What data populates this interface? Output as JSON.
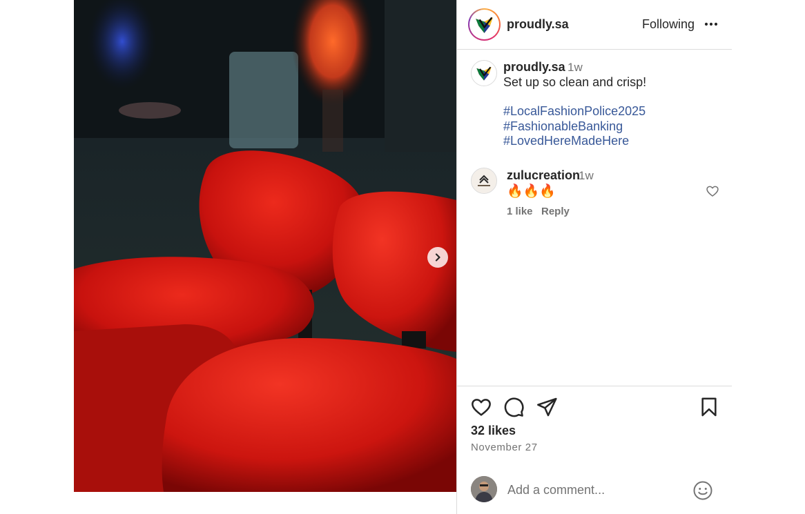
{
  "post": {
    "username": "proudly.sa",
    "follow_status": "Following",
    "more_icon": "more-horizontal-icon"
  },
  "caption": {
    "username": "proudly.sa",
    "time": "1w",
    "text": "Set up so clean and crisp!",
    "hashtags": [
      "#LocalFashionPolice2025",
      "#FashionableBanking",
      "#LovedHereMadeHere"
    ]
  },
  "comment": {
    "username": "zulucreation",
    "time": "1w",
    "text": "🔥🔥🔥",
    "likes": "1 like",
    "reply_label": "Reply"
  },
  "actions": {
    "likes": "32 likes",
    "date": "November 27",
    "icons": [
      "heart-icon",
      "comment-icon",
      "share-icon",
      "bookmark-icon"
    ]
  },
  "add_comment": {
    "placeholder": "Add a comment..."
  },
  "colors": {
    "hashtag": "#385898",
    "muted": "#737373",
    "border": "#dbdbdb",
    "sofa_red": "#c8120e"
  }
}
